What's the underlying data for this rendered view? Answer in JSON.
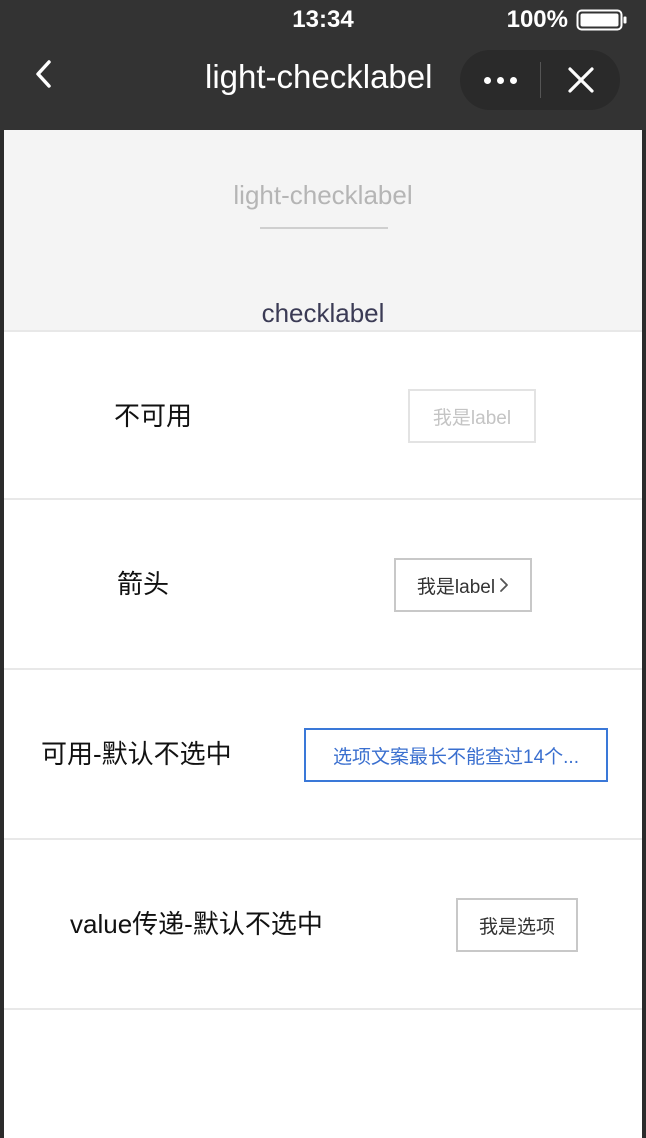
{
  "status_bar": {
    "time": "13:34",
    "battery_percent": "100%"
  },
  "nav_bar": {
    "title": "light-checklabel",
    "back_icon": "chevron-left-icon",
    "more_icon": "more-dots-icon",
    "close_icon": "close-icon"
  },
  "banner": {
    "title": "light-checklabel",
    "subtitle": "checklabel"
  },
  "rows": [
    {
      "label": "不可用",
      "chip_text": "我是label",
      "state": "disabled"
    },
    {
      "label": "箭头",
      "chip_text": "我是label",
      "state": "normal",
      "has_arrow": true
    },
    {
      "label": "可用-默认不选中",
      "chip_text": "选项文案最长不能查过14个...",
      "state": "active"
    },
    {
      "label": "value传递-默认不选中",
      "chip_text": "我是选项",
      "state": "normal"
    }
  ],
  "colors": {
    "nav_background": "#333333",
    "banner_background": "#f4f4f4",
    "accent": "#3a78d8",
    "disabled_text": "#c4c4c4"
  }
}
